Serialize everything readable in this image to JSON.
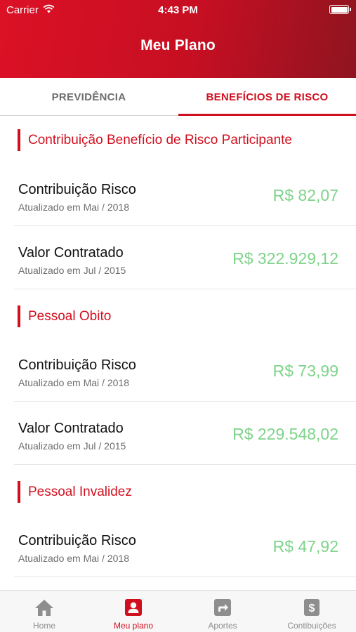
{
  "status_bar": {
    "carrier": "Carrier",
    "time": "4:43 PM"
  },
  "header": {
    "title": "Meu Plano"
  },
  "tabs": [
    {
      "label": "PREVIDÊNCIA",
      "active": false
    },
    {
      "label": "BENEFÍCIOS DE RISCO",
      "active": true
    }
  ],
  "sections": [
    {
      "title": "Contribuição Benefício de Risco Participante",
      "rows": [
        {
          "label": "Contribuição Risco",
          "updated": "Atualizado em Mai / 2018",
          "value": "R$ 82,07"
        },
        {
          "label": "Valor Contratado",
          "updated": "Atualizado em Jul / 2015",
          "value": "R$ 322.929,12"
        }
      ]
    },
    {
      "title": "Pessoal Obito",
      "rows": [
        {
          "label": "Contribuição Risco",
          "updated": "Atualizado em Mai / 2018",
          "value": "R$ 73,99"
        },
        {
          "label": "Valor Contratado",
          "updated": "Atualizado em Jul / 2015",
          "value": "R$ 229.548,02"
        }
      ]
    },
    {
      "title": "Pessoal Invalidez",
      "rows": [
        {
          "label": "Contribuição Risco",
          "updated": "Atualizado em Mai / 2018",
          "value": "R$ 47,92"
        }
      ]
    }
  ],
  "tabbar": [
    {
      "label": "Home",
      "icon": "home-icon",
      "active": false
    },
    {
      "label": "Meu plano",
      "icon": "person-card-icon",
      "active": true
    },
    {
      "label": "Aportes",
      "icon": "share-arrow-icon",
      "active": false
    },
    {
      "label": "Contibuições",
      "icon": "dollar-icon",
      "active": false
    }
  ],
  "colors": {
    "brand_red": "#d0101f",
    "value_green": "#7ed38a",
    "tab_inactive": "#8e8e8e"
  }
}
